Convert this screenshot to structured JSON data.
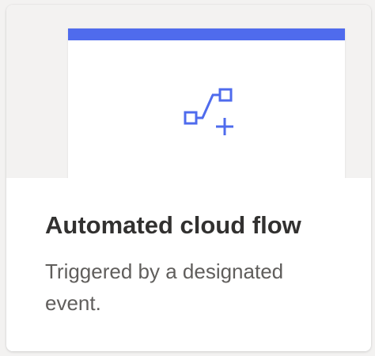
{
  "card": {
    "title": "Automated cloud flow",
    "description": "Triggered by a designated event.",
    "icon": "flow-connector-add-icon",
    "colors": {
      "accent": "#4f6bed",
      "title": "#323130",
      "description": "#605e5c",
      "preview_background": "#f3f2f1"
    }
  }
}
